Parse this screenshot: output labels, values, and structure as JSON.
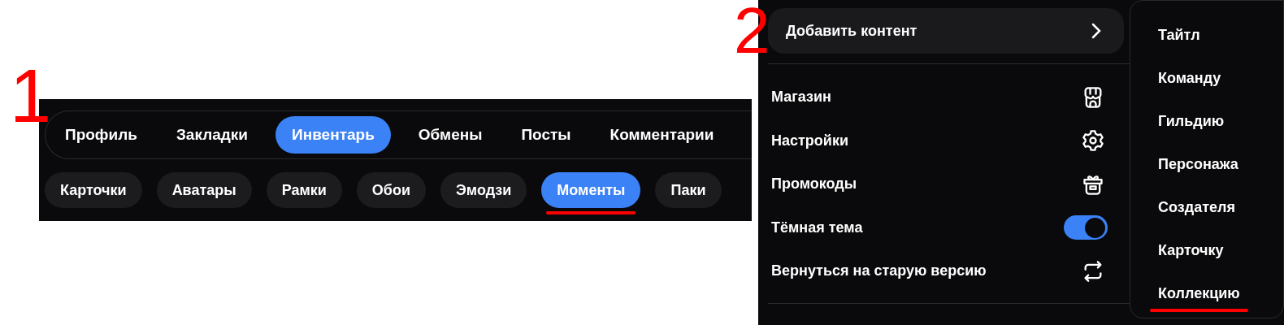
{
  "annotations": [
    {
      "label": "1"
    },
    {
      "label": "2"
    }
  ],
  "profile_tabs": [
    {
      "label": "Профиль",
      "selected": false
    },
    {
      "label": "Закладки",
      "selected": false
    },
    {
      "label": "Инвентарь",
      "selected": true
    },
    {
      "label": "Обмены",
      "selected": false
    },
    {
      "label": "Посты",
      "selected": false
    },
    {
      "label": "Комментарии",
      "selected": false
    }
  ],
  "inventory_tabs": [
    {
      "label": "Карточки",
      "selected": false,
      "underlined": false
    },
    {
      "label": "Аватары",
      "selected": false,
      "underlined": false
    },
    {
      "label": "Рамки",
      "selected": false,
      "underlined": false
    },
    {
      "label": "Обои",
      "selected": false,
      "underlined": false
    },
    {
      "label": "Эмодзи",
      "selected": false,
      "underlined": false
    },
    {
      "label": "Моменты",
      "selected": true,
      "underlined": true
    },
    {
      "label": "Паки",
      "selected": false,
      "underlined": false
    }
  ],
  "menu": {
    "add_content": "Добавить контент",
    "items": [
      {
        "kind": "shop",
        "label": "Магазин"
      },
      {
        "kind": "settings",
        "label": "Настройки"
      },
      {
        "kind": "gift",
        "label": "Промокоды"
      },
      {
        "kind": "toggle",
        "label": "Тёмная тема",
        "on": true
      },
      {
        "kind": "switch",
        "label": "Вернуться на старую версию"
      }
    ]
  },
  "submenu": [
    {
      "label": "Тайтл",
      "underlined": false
    },
    {
      "label": "Команду",
      "underlined": false
    },
    {
      "label": "Гильдию",
      "underlined": false
    },
    {
      "label": "Персонажа",
      "underlined": false
    },
    {
      "label": "Создателя",
      "underlined": false
    },
    {
      "label": "Карточку",
      "underlined": false
    },
    {
      "label": "Коллекцию",
      "underlined": true
    }
  ]
}
